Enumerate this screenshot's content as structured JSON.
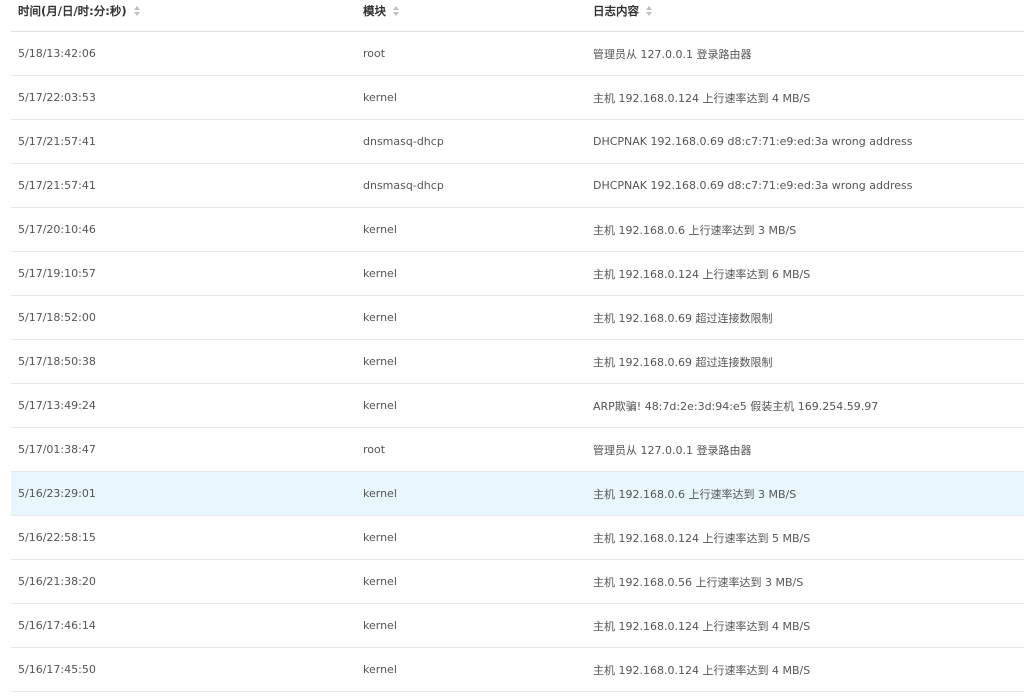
{
  "columns": {
    "time": "时间(月/日/时:分:秒)",
    "module": "模块",
    "content": "日志内容"
  },
  "icons": {
    "sort": "sort-caret-icon"
  },
  "colors": {
    "highlight_row": "#e8f6fd",
    "divider": "#e8e8e8"
  },
  "rows": [
    {
      "time": "5/18/13:42:06",
      "module": "root",
      "content": "管理员从 127.0.0.1 登录路由器"
    },
    {
      "time": "5/17/22:03:53",
      "module": "kernel",
      "content": "主机 192.168.0.124 上行速率达到 4 MB/S"
    },
    {
      "time": "5/17/21:57:41",
      "module": "dnsmasq-dhcp",
      "content": "DHCPNAK 192.168.0.69 d8:c7:71:e9:ed:3a wrong address"
    },
    {
      "time": "5/17/21:57:41",
      "module": "dnsmasq-dhcp",
      "content": "DHCPNAK 192.168.0.69 d8:c7:71:e9:ed:3a wrong address"
    },
    {
      "time": "5/17/20:10:46",
      "module": "kernel",
      "content": "主机 192.168.0.6 上行速率达到 3 MB/S"
    },
    {
      "time": "5/17/19:10:57",
      "module": "kernel",
      "content": "主机 192.168.0.124 上行速率达到 6 MB/S"
    },
    {
      "time": "5/17/18:52:00",
      "module": "kernel",
      "content": "主机 192.168.0.69 超过连接数限制"
    },
    {
      "time": "5/17/18:50:38",
      "module": "kernel",
      "content": "主机 192.168.0.69 超过连接数限制"
    },
    {
      "time": "5/17/13:49:24",
      "module": "kernel",
      "content": "ARP欺骗! 48:7d:2e:3d:94:e5 假装主机 169.254.59.97"
    },
    {
      "time": "5/17/01:38:47",
      "module": "root",
      "content": "管理员从 127.0.0.1 登录路由器"
    },
    {
      "time": "5/16/23:29:01",
      "module": "kernel",
      "content": "主机 192.168.0.6 上行速率达到 3 MB/S"
    },
    {
      "time": "5/16/22:58:15",
      "module": "kernel",
      "content": "主机 192.168.0.124 上行速率达到 5 MB/S"
    },
    {
      "time": "5/16/21:38:20",
      "module": "kernel",
      "content": "主机 192.168.0.56 上行速率达到 3 MB/S"
    },
    {
      "time": "5/16/17:46:14",
      "module": "kernel",
      "content": "主机 192.168.0.124 上行速率达到 4 MB/S"
    },
    {
      "time": "5/16/17:45:50",
      "module": "kernel",
      "content": "主机 192.168.0.124 上行速率达到 4 MB/S"
    }
  ]
}
